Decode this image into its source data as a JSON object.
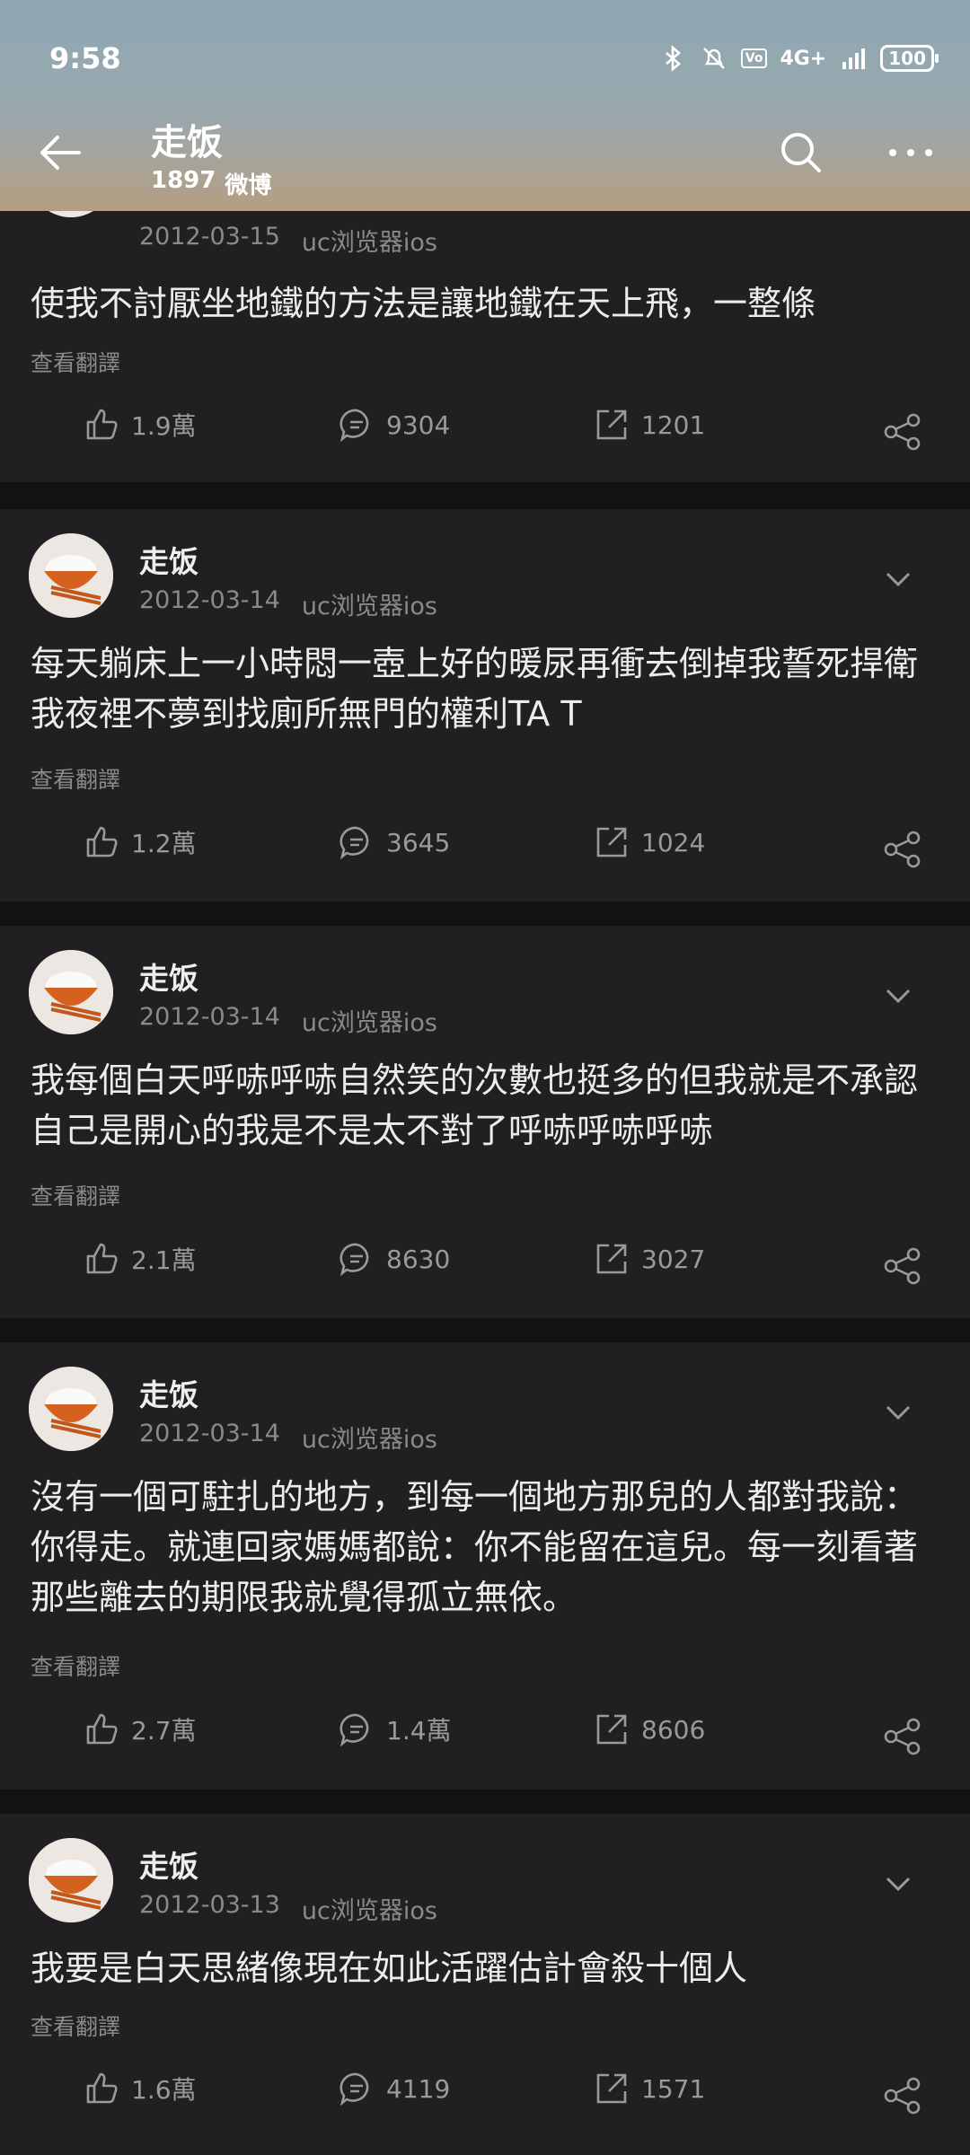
{
  "status": {
    "time": "9:58",
    "network": "4G+",
    "battery": "100"
  },
  "header": {
    "title": "走饭",
    "count": "1897",
    "count_label": "微博"
  },
  "posts": [
    {
      "author": "",
      "date": "2012-03-15",
      "source": "uc浏览器ios",
      "text": "使我不討厭坐地鐵的方法是讓地鐵在天上飛，一整條",
      "translate": "查看翻譯",
      "likes": "1.9萬",
      "comments": "9304",
      "reposts": "1201"
    },
    {
      "author": "走饭",
      "date": "2012-03-14",
      "source": "uc浏览器ios",
      "text": "每天躺床上一小時悶一壺上好的暖尿再衝去倒掉我誓死捍衛我夜裡不夢到找廁所無門的權利TA T",
      "translate": "查看翻譯",
      "likes": "1.2萬",
      "comments": "3645",
      "reposts": "1024"
    },
    {
      "author": "走饭",
      "date": "2012-03-14",
      "source": "uc浏览器ios",
      "text": "我每個白天呼哧呼哧自然笑的次數也挺多的但我就是不承認自己是開心的我是不是太不對了呼哧呼哧呼哧",
      "translate": "查看翻譯",
      "likes": "2.1萬",
      "comments": "8630",
      "reposts": "3027"
    },
    {
      "author": "走饭",
      "date": "2012-03-14",
      "source": "uc浏览器ios",
      "text": "沒有一個可駐扎的地方，到每一個地方那兒的人都對我說：你得走。就連回家媽媽都說：你不能留在這兒。每一刻看著那些離去的期限我就覺得孤立無依。",
      "translate": "查看翻譯",
      "likes": "2.7萬",
      "comments": "1.4萬",
      "reposts": "8606"
    },
    {
      "author": "走饭",
      "date": "2012-03-13",
      "source": "uc浏览器ios",
      "text": "我要是白天思緒像現在如此活躍估計會殺十個人",
      "translate": "查看翻譯",
      "likes": "1.6萬",
      "comments": "4119",
      "reposts": "1571"
    }
  ],
  "colors": {
    "background": "#121214",
    "card": "#202022",
    "muted": "#8a8a8d"
  }
}
